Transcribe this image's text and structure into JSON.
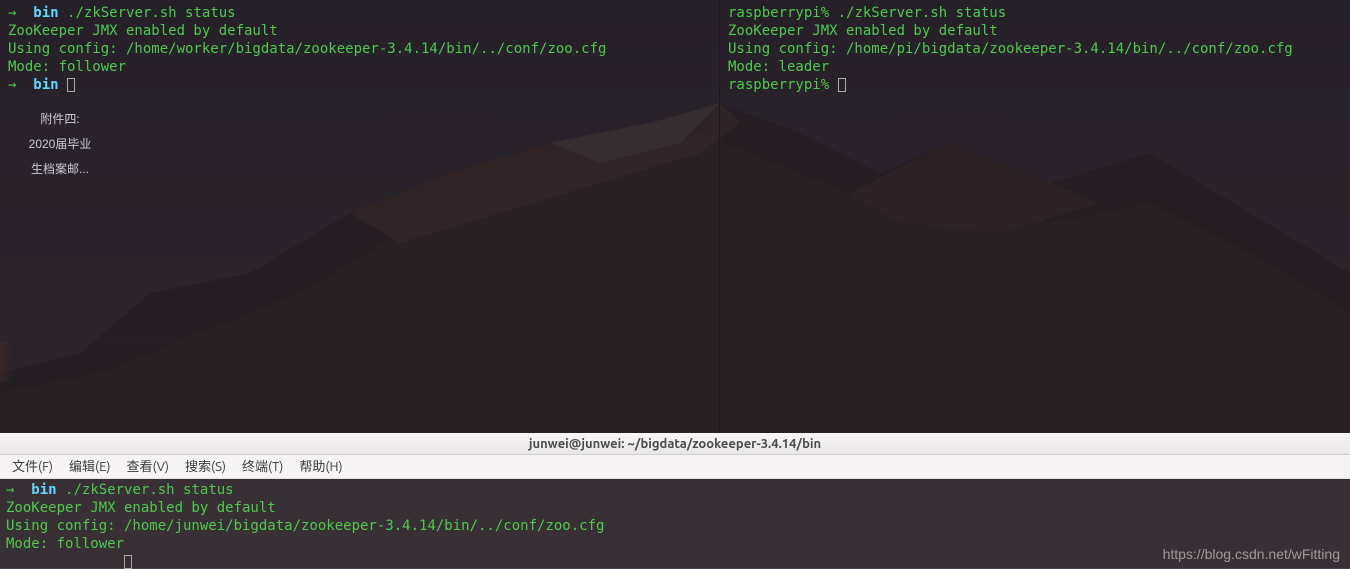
{
  "top_left": {
    "prompt_arrow": "→",
    "cwd": "bin",
    "command": "./zkServer.sh status",
    "line1": "ZooKeeper JMX enabled by default",
    "line2": "Using config: /home/worker/bigdata/zookeeper-3.4.14/bin/../conf/zoo.cfg",
    "line3": "Mode: follower",
    "prompt2_arrow": "→",
    "prompt2_cwd": "bin"
  },
  "top_right": {
    "prompt": "raspberrypi%",
    "command": "./zkServer.sh status",
    "line1": "ZooKeeper JMX enabled by default",
    "line2": "Using config: /home/pi/bigdata/zookeeper-3.4.14/bin/../conf/zoo.cfg",
    "line3": "Mode: leader",
    "prompt2": "raspberrypi%"
  },
  "desktop": {
    "icon1": "附件四:",
    "icon2": "2020届毕业",
    "icon3": "生档案邮..."
  },
  "bottom": {
    "titlebar": "junwei@junwei: ~/bigdata/zookeeper-3.4.14/bin",
    "menu": {
      "file": "文件(F)",
      "edit": "编辑(E)",
      "view": "查看(V)",
      "search": "搜索(S)",
      "terminal": "终端(T)",
      "help": "帮助(H)"
    },
    "term": {
      "prompt_arrow": "→",
      "cwd": "bin",
      "command": "./zkServer.sh status",
      "line1": "ZooKeeper JMX enabled by default",
      "line2": "Using config: /home/junwei/bigdata/zookeeper-3.4.14/bin/../conf/zoo.cfg",
      "line3": "Mode: follower"
    }
  },
  "watermark": "https://blog.csdn.net/wFitting"
}
